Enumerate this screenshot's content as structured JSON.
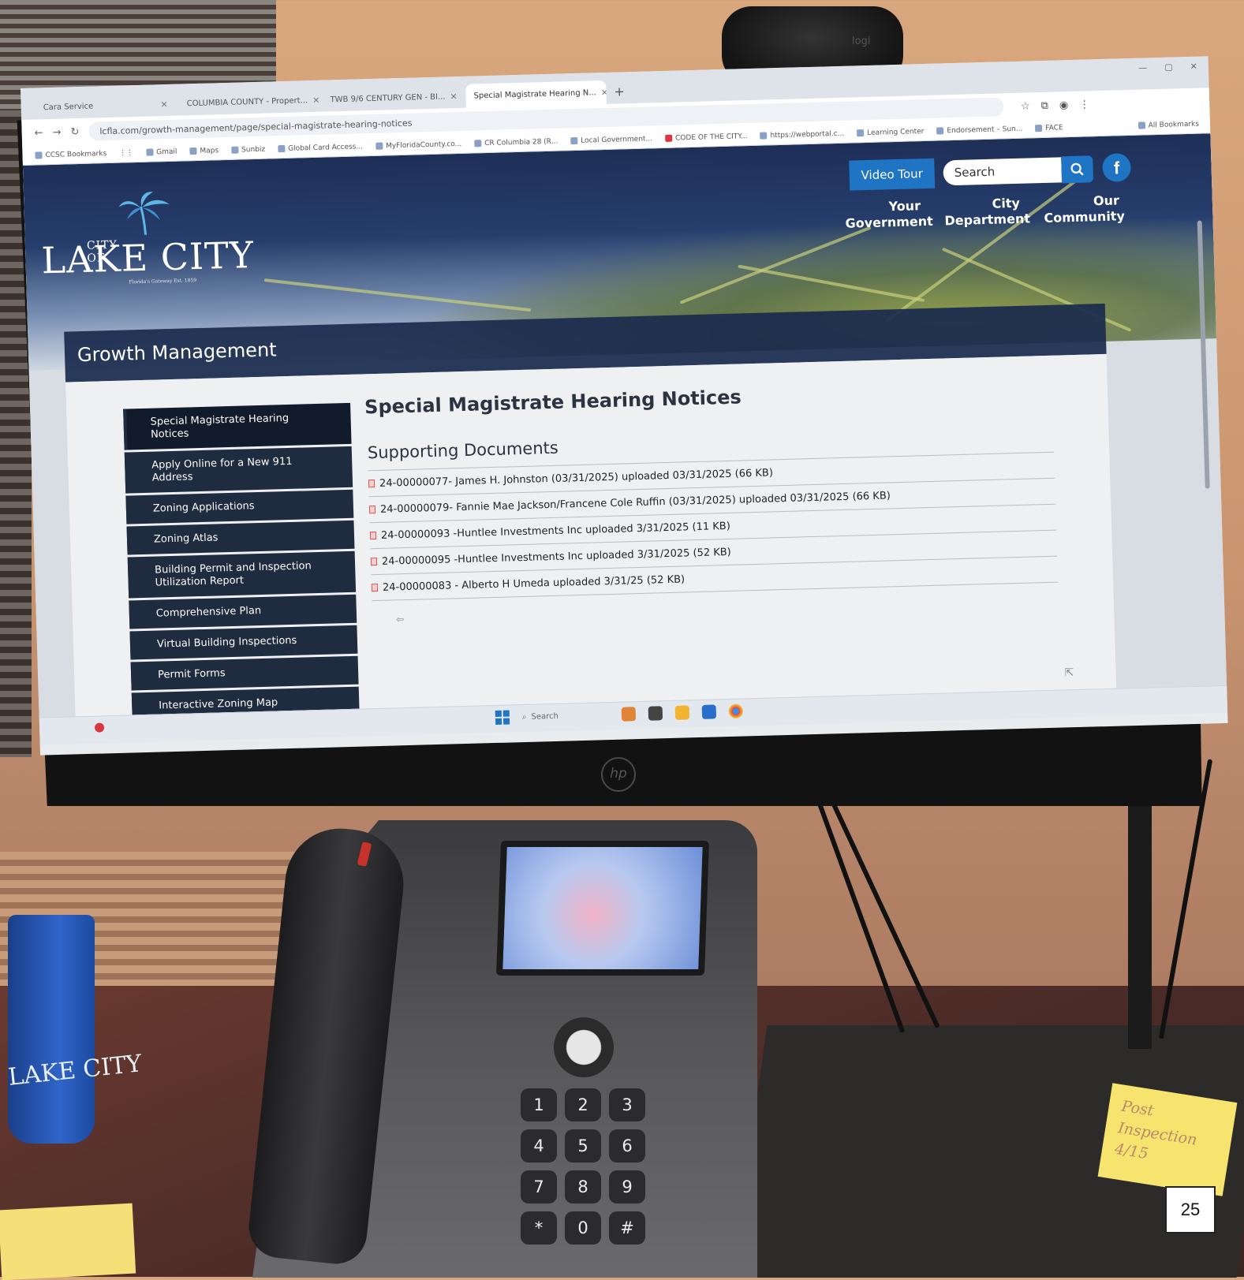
{
  "browser": {
    "tabs": [
      {
        "label": "Cara Service",
        "active": false
      },
      {
        "label": "COLUMBIA COUNTY - Propert...",
        "active": false
      },
      {
        "label": "TWB 9/6 CENTURY GEN - BI...",
        "active": false
      },
      {
        "label": "Special Magistrate Hearing N...",
        "active": true
      }
    ],
    "new_tab": "+",
    "url": "lcfla.com/growth-management/page/special-magistrate-hearing-notices",
    "bookmarks": [
      "CCSC Bookmarks",
      "Gmail",
      "Maps",
      "Sunbiz",
      "Global Card Access...",
      "MyFloridaCounty.co...",
      "CR Columbia 28 (R...",
      "Local Government...",
      "CODE OF THE CITY...",
      "https://webportal.c...",
      "Learning Center",
      "Endorsement – Sun...",
      "FACE"
    ],
    "all_bookmarks": "All Bookmarks"
  },
  "site": {
    "logo": {
      "small": "CITY OF",
      "name": "LAKE CITY",
      "tagline": "Florida's Gateway Est. 1859"
    },
    "video_tour": "Video Tour",
    "search_placeholder": "Search",
    "facebook": "f",
    "nav": [
      {
        "label": "Your\nGovernment"
      },
      {
        "label": "City\nDepartment"
      },
      {
        "label": "Our\nCommunity"
      }
    ],
    "section_title": "Growth Management",
    "sidebar": [
      "Special Magistrate Hearing Notices",
      "Apply Online for a New 911 Address",
      "Zoning Applications",
      "Zoning Atlas",
      "Building Permit and Inspection Utilization Report",
      "Comprehensive Plan",
      "Virtual Building Inspections",
      "Permit Forms",
      "Interactive Zoning Map"
    ],
    "page_title": "Special Magistrate Hearing Notices",
    "docs_title": "Supporting Documents",
    "documents": [
      "24-00000077- James H. Johnston (03/31/2025) uploaded 03/31/2025 (66 KB)",
      "24-00000079- Fannie Mae Jackson/Francene Cole Ruffin (03/31/2025) uploaded 03/31/2025 (66 KB)",
      "24-00000093 -Huntlee Investments Inc uploaded 3/31/2025 (11 KB)",
      "24-00000095 -Huntlee Investments Inc uploaded 3/31/2025 (52 KB)",
      "24-00000083 - Alberto H Umeda uploaded 3/31/25 (52 KB)"
    ]
  },
  "taskbar": {
    "search": "Search"
  },
  "photo": {
    "webcam_label": "logi",
    "monitor_brand": "hp",
    "sticky_note": "Post Inspection 4/15",
    "page_number": "25",
    "mug_text": "LAKE CITY"
  },
  "phone": {
    "keys": [
      "1",
      "2",
      "3",
      "4",
      "5",
      "6",
      "7",
      "8",
      "9",
      "*",
      "0",
      "#"
    ]
  },
  "colors": {
    "accent": "#1f74c3",
    "navy": "#1a2a4d",
    "sidebar": "#1f2b3e"
  }
}
